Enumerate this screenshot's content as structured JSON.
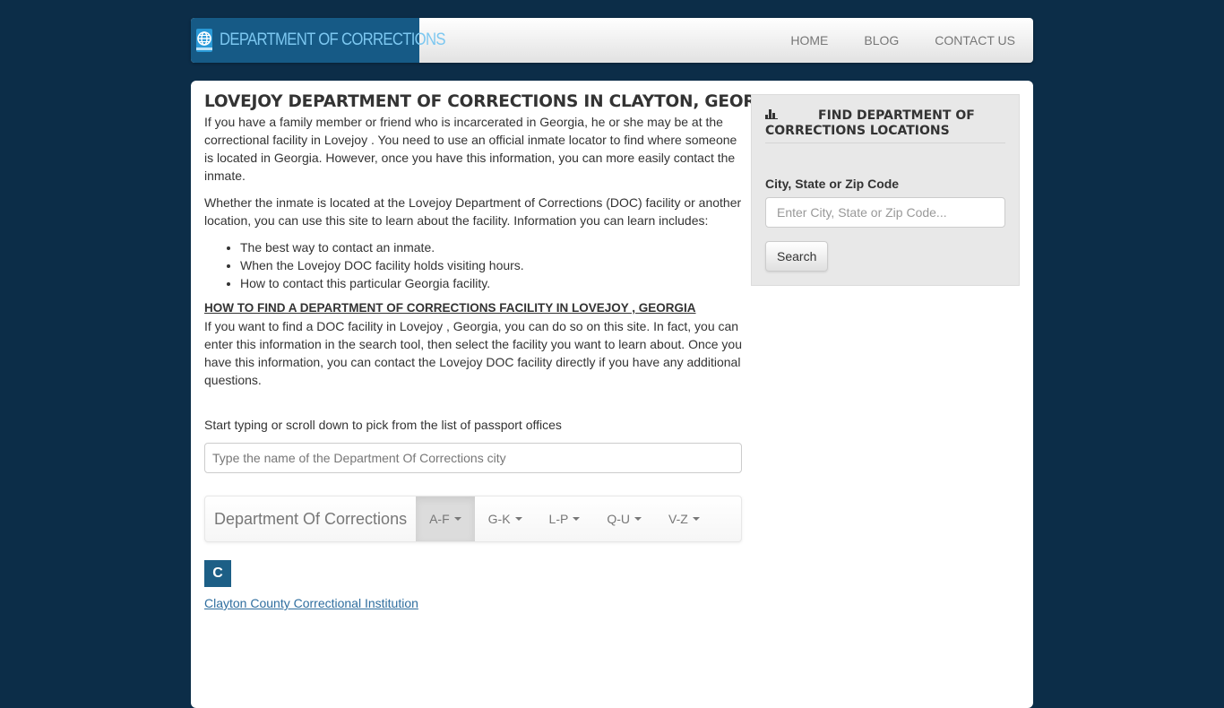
{
  "header": {
    "brand": "DEPARTMENT OF CORRECTIONS",
    "brand_icon": "globe-passport-icon",
    "nav": [
      {
        "label": "HOME"
      },
      {
        "label": "BLOG"
      },
      {
        "label": "CONTACT US"
      }
    ]
  },
  "main": {
    "title": "LOVEJOY DEPARTMENT OF CORRECTIONS IN CLAYTON, GEORGIA",
    "intro": "If you have a family member or friend who is incarcerated in Georgia, he or she may be at the correctional facility in Lovejoy . You need to use an official inmate locator to find where someone is located in Georgia. However, once you have this information, you can more easily contact the inmate.",
    "para2": "Whether the inmate is located at the Lovejoy Department of Corrections (DOC) facility or another location, you can use this site to learn about the facility. Information you can learn includes:",
    "bullets": [
      "The best way to contact an inmate.",
      "When the Lovejoy DOC facility holds visiting hours.",
      "How to contact this particular Georgia facility."
    ],
    "subheading": "HOW TO FIND A DEPARTMENT OF CORRECTIONS FACILITY IN LOVEJOY , GEORGIA",
    "para3": "If you want to find a DOC facility in Lovejoy , Georgia, you can do so on this site. In fact, you can enter this information in the search tool, then select the facility you want to learn about. Once you have this information, you can contact the Lovejoy DOC facility directly if you have any additional questions.",
    "pick_text": "Start typing or scroll down to pick from the list of passport offices",
    "city_input": {
      "placeholder": "Type the name of the Department Of Corrections city",
      "value": ""
    },
    "letters_nav": {
      "brand": "Department Of Corrections",
      "items": [
        {
          "label": "A-F",
          "active": true
        },
        {
          "label": "G-K",
          "active": false
        },
        {
          "label": "L-P",
          "active": false
        },
        {
          "label": "Q-U",
          "active": false
        },
        {
          "label": "V-Z",
          "active": false
        }
      ]
    },
    "groups": [
      {
        "letter": "C",
        "links": [
          "Clayton County Correctional Institution"
        ]
      }
    ]
  },
  "sidebar": {
    "title": "FIND DEPARTMENT OF CORRECTIONS LOCATIONS",
    "title_icon": "bar-chart-icon",
    "label": "City, State or Zip Code",
    "input": {
      "placeholder": "Enter City, State or Zip Code...",
      "value": ""
    },
    "button": "Search"
  },
  "colors": {
    "page_bg": "#0c2d48",
    "brand_bg": "#165a86",
    "brand_text": "#7cc7f0",
    "letter_badge": "#1d5f86",
    "link": "#2f6e9f",
    "sidebar_bg": "#e8e8e8"
  }
}
